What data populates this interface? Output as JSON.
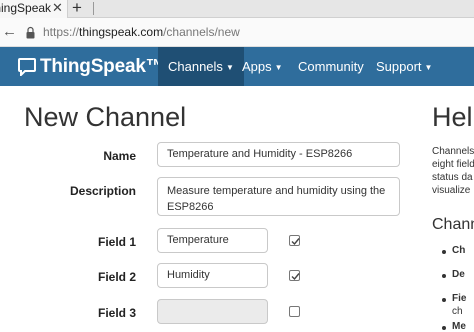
{
  "browser": {
    "tab_title": "ThingSpeak",
    "tab_close": "✕",
    "new_tab": "+",
    "back": "←",
    "url_prefix": "https://",
    "url_host": "thingspeak.com",
    "url_path": "/channels/new"
  },
  "navbar": {
    "brand": "ThingSpeak™",
    "items": [
      {
        "label": "Channels",
        "caret": "▼",
        "active": true
      },
      {
        "label": "Apps",
        "caret": "▼",
        "active": false
      },
      {
        "label": "Community",
        "caret": "",
        "active": false
      },
      {
        "label": "Support",
        "caret": "▼",
        "active": false
      }
    ],
    "color": "#2f6d9c",
    "active_color": "#1f4f74"
  },
  "form": {
    "title": "New Channel",
    "name": {
      "label": "Name",
      "value": "Temperature and Humidity - ESP8266"
    },
    "description": {
      "label": "Description",
      "value_line1": "Measure temperature and humidity using the",
      "value_line2": "ESP8266"
    },
    "fields": [
      {
        "label": "Field 1",
        "value": "Temperature",
        "checked": true
      },
      {
        "label": "Field 2",
        "value": "Humidity",
        "checked": true
      },
      {
        "label": "Field 3",
        "value": "",
        "checked": false
      }
    ]
  },
  "help": {
    "title": "Hel",
    "lines": [
      "Channels",
      "eight field",
      "status da",
      "visualize"
    ],
    "subtitle": "Chann",
    "bullets": [
      "Ch",
      "De",
      "Fie",
      "ch",
      "Me"
    ]
  }
}
